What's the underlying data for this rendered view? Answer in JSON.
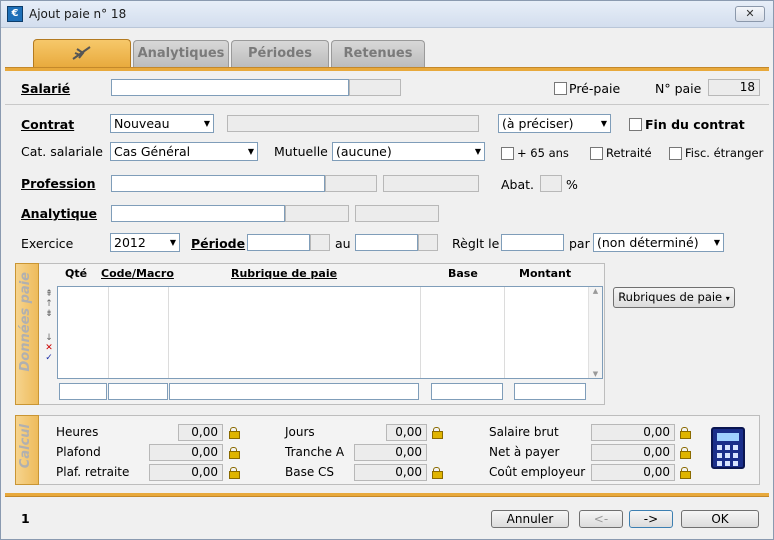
{
  "window": {
    "title": "Ajout paie n° 18",
    "close": "✕"
  },
  "tabs": [
    {
      "label": ""
    },
    {
      "label": "Analytiques"
    },
    {
      "label": "Périodes"
    },
    {
      "label": "Retenues"
    }
  ],
  "salarie": {
    "label": "Salarié",
    "prepaie_label": "Pré-paie",
    "npaie_label": "N° paie",
    "npaie_value": "18"
  },
  "contrat": {
    "label": "Contrat",
    "value": "Nouveau",
    "type_value": "(à préciser)",
    "fin_label": "Fin du contrat"
  },
  "cat": {
    "label": "Cat. salariale",
    "value": "Cas Général",
    "mutuelle_label": "Mutuelle",
    "mutuelle_value": "(aucune)",
    "plus65_label": "+ 65 ans",
    "retraite_label": "Retraité",
    "fisc_label": "Fisc. étranger"
  },
  "profession": {
    "label": "Profession",
    "abat_label": "Abat.",
    "pct": "%"
  },
  "analytique": {
    "label": "Analytique"
  },
  "exercice": {
    "label": "Exercice",
    "value": "2012",
    "periode_label": "Période",
    "au_label": "au",
    "reglt_label": "Règlt le",
    "par_label": "par",
    "par_value": "(non déterminé)"
  },
  "donnees": {
    "vtitle": "Données paie",
    "headers": {
      "qte": "Qté",
      "code": "Code",
      "macro": "/Macro",
      "rubrique": "Rubrique de paie",
      "base": "Base",
      "montant": "Montant"
    },
    "rubriques_button": "Rubriques de paie"
  },
  "calcul": {
    "vtitle": "Calcul",
    "heures": {
      "label": "Heures",
      "value": "0,00"
    },
    "plafond": {
      "label": "Plafond",
      "value": "0,00"
    },
    "plaf_retraite": {
      "label": "Plaf. retraite",
      "value": "0,00"
    },
    "jours": {
      "label": "Jours",
      "value": "0,00"
    },
    "tranche_a": {
      "label": "Tranche A",
      "value": "0,00"
    },
    "base_cs": {
      "label": "Base CS",
      "value": "0,00"
    },
    "salaire_brut": {
      "label": "Salaire brut",
      "value": "0,00"
    },
    "net_payer": {
      "label": "Net à payer",
      "value": "0,00"
    },
    "cout_employeur": {
      "label": "Coût employeur",
      "value": "0,00"
    }
  },
  "footer": {
    "page": "1",
    "annuler": "Annuler",
    "prev": "<-",
    "next": "->",
    "ok": "OK"
  }
}
